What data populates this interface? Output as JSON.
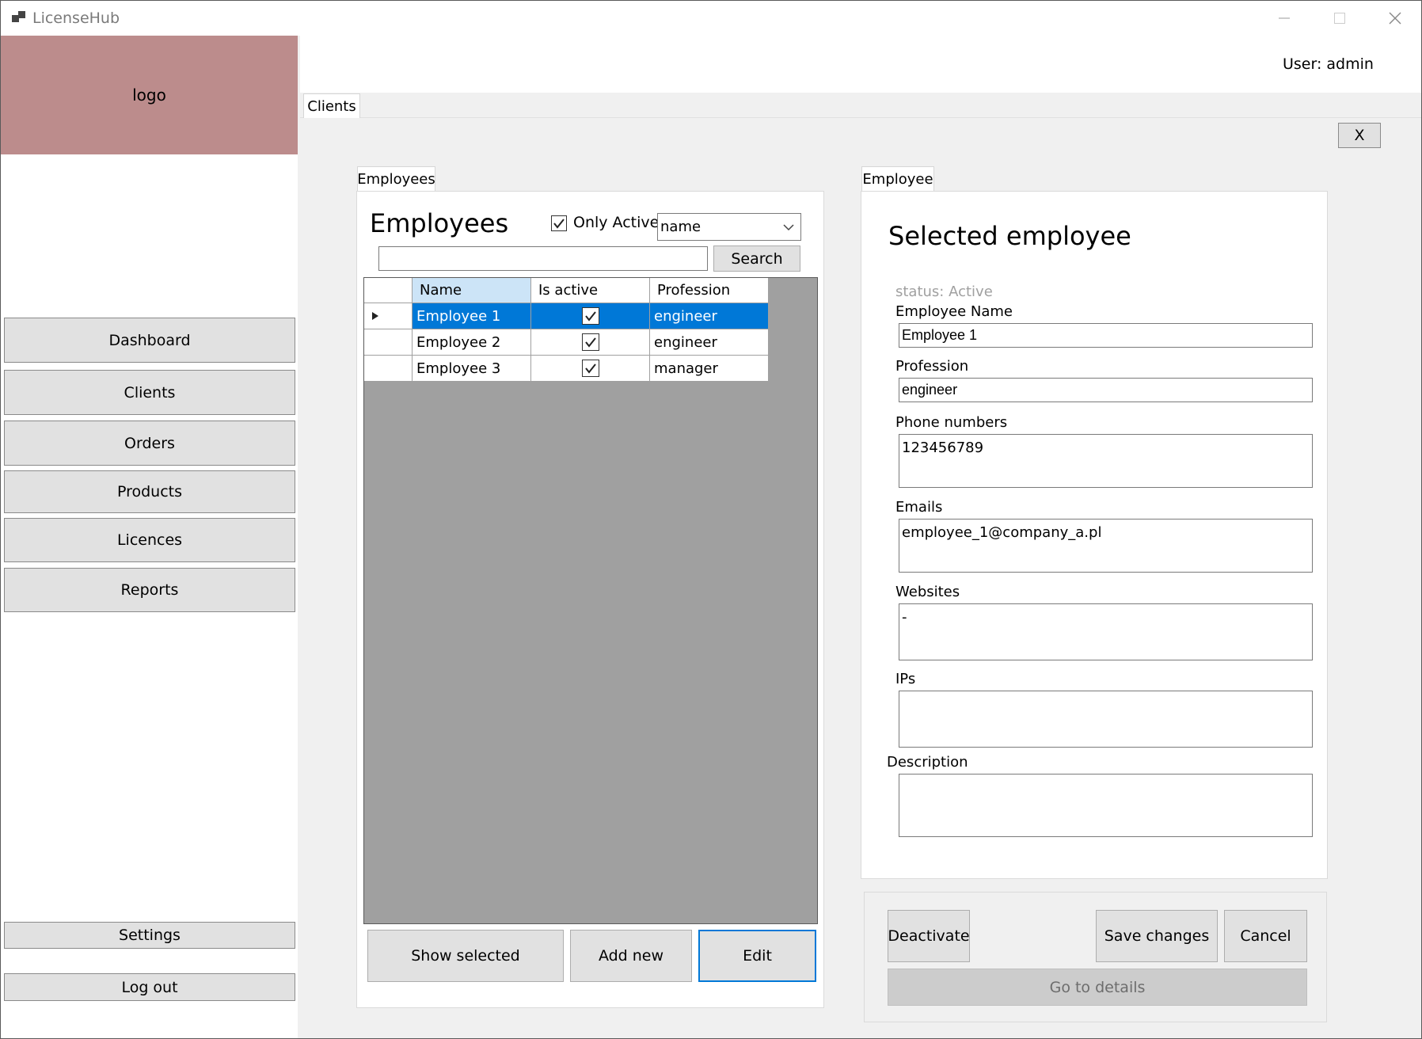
{
  "window": {
    "title": "LicenseHub"
  },
  "sidebar": {
    "logo_text": "logo",
    "items": [
      {
        "label": "Dashboard"
      },
      {
        "label": "Clients"
      },
      {
        "label": "Orders"
      },
      {
        "label": "Products"
      },
      {
        "label": "Licences"
      },
      {
        "label": "Reports"
      }
    ],
    "settings_label": "Settings",
    "logout_label": "Log out"
  },
  "header": {
    "user_label": "User: admin"
  },
  "main_tab": {
    "label": "Clients",
    "close_label": "X"
  },
  "employees_panel": {
    "tab_label": "Employees",
    "heading": "Employees",
    "only_active_label": "Only Active",
    "only_active_checked": true,
    "sort_select_value": "name",
    "search_value": "",
    "search_button": "Search",
    "columns": [
      "Name",
      "Is active",
      "Profession"
    ],
    "rows": [
      {
        "name": "Employee 1",
        "active": true,
        "profession": "engineer",
        "selected": true
      },
      {
        "name": "Employee 2",
        "active": true,
        "profession": "engineer",
        "selected": false
      },
      {
        "name": "Employee 3",
        "active": true,
        "profession": "manager",
        "selected": false
      }
    ],
    "show_selected_button": "Show selected",
    "add_new_button": "Add new",
    "edit_button": "Edit"
  },
  "employee_panel": {
    "tab_label": "Employee",
    "heading": "Selected employee",
    "status_text": "status: Active",
    "name_label": "Employee Name",
    "name_value": "Employee 1",
    "profession_label": "Profession",
    "profession_value": "engineer",
    "phones_label": "Phone numbers",
    "phones_value": "123456789",
    "emails_label": "Emails",
    "emails_value": "employee_1@company_a.pl",
    "websites_label": "Websites",
    "websites_value": "-",
    "ips_label": "IPs",
    "ips_value": "",
    "description_label": "Description",
    "description_value": "",
    "deactivate_button": "Deactivate",
    "save_button": "Save changes",
    "cancel_button": "Cancel",
    "details_button": "Go to details"
  },
  "colors": {
    "selection": "#0078d7",
    "logo_bg": "#bc8c8c",
    "grid_bg": "#a0a0a0"
  }
}
